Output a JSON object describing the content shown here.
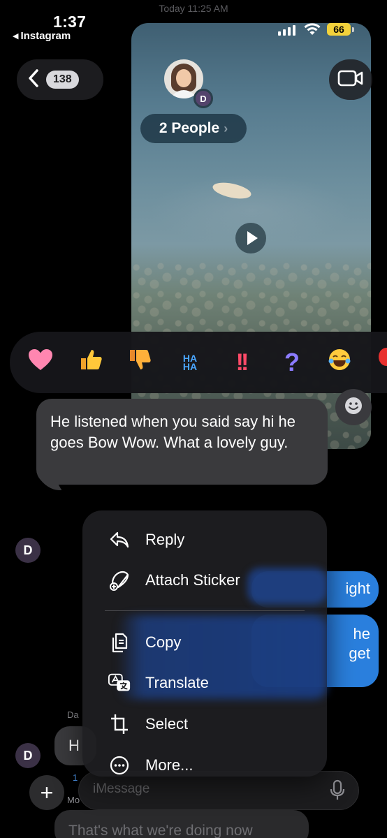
{
  "status_bar": {
    "time": "1:37",
    "back_app": "Instagram",
    "battery": "66"
  },
  "timestamp": "Today 11:25 AM",
  "header": {
    "back_count": "138",
    "avatar_badge": "D",
    "group_label": "2 People"
  },
  "reactions": [
    "heart",
    "thumbs-up",
    "thumbs-down",
    "haha",
    "exclamation",
    "question",
    "laughing",
    "balloon"
  ],
  "reaction_text": {
    "haha_top": "HA",
    "haha_bottom": "HA",
    "exclamation": "!!",
    "question": "?"
  },
  "selected_message": {
    "text": "He listened when you said say hi he goes Bow Wow. What a lovely guy."
  },
  "context_menu": {
    "items": [
      {
        "label": "Reply",
        "icon": "reply-icon"
      },
      {
        "label": "Attach Sticker",
        "icon": "sticker-icon"
      },
      {
        "label": "Copy",
        "icon": "copy-icon"
      },
      {
        "label": "Translate",
        "icon": "translate-icon"
      },
      {
        "label": "Select",
        "icon": "crop-icon"
      },
      {
        "label": "More...",
        "icon": "more-icon"
      }
    ]
  },
  "background": {
    "avatar_initial": "D",
    "blue_bubble_1": "ight",
    "blue_bubble_2_line1": "he",
    "blue_bubble_2_line2": "get",
    "sender": "Da",
    "gray_bubble": "H",
    "meta_1": "1",
    "meta_2": "Mo",
    "faded_bubble": "That's what we're doing now"
  },
  "compose": {
    "placeholder": "iMessage"
  },
  "colors": {
    "accent_blue": "#2a7fdd",
    "battery_yellow": "#f3d23b",
    "menu_bg": "#1e1e21",
    "bubble_gray": "#3a3a3d"
  }
}
